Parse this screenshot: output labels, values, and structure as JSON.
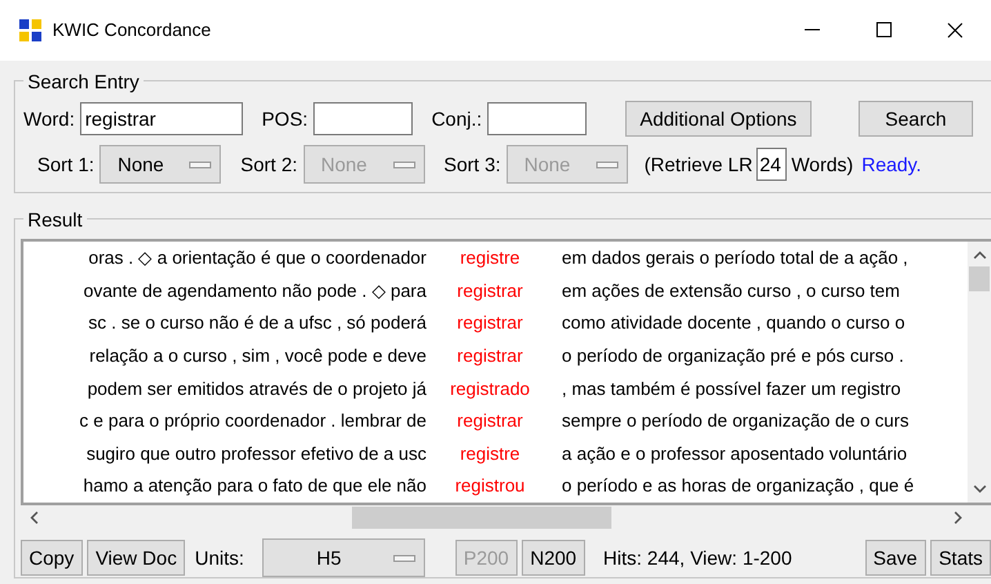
{
  "window": {
    "title": "KWIC Concordance"
  },
  "search_entry": {
    "legend": "Search Entry",
    "word": {
      "label": "Word:",
      "value": "registrar"
    },
    "pos": {
      "label": "POS:"
    },
    "conj": {
      "label": "Conj.:"
    },
    "buttons": [
      "Additional Options",
      "Search"
    ],
    "sorts": [
      {
        "label": "Sort 1:",
        "value": "None",
        "disabled": false
      },
      {
        "label": "Sort 2:",
        "value": "None",
        "disabled": true
      },
      {
        "label": "Sort 3:",
        "value": "None",
        "disabled": true
      }
    ],
    "retrieve_prefix": "(Retrieve LR",
    "retrieve_value": "24",
    "retrieve_suffix": "Words)",
    "status": "Ready."
  },
  "result": {
    "legend": "Result",
    "rows": [
      {
        "left": "oras . ◇ a orientação é que o coordenador",
        "keyword": "registre",
        "right": "em dados gerais o período total de a ação ,"
      },
      {
        "left": "ovante de agendamento não pode . ◇ para",
        "keyword": "registrar",
        "right": "em ações de extensão curso , o curso tem"
      },
      {
        "left": "sc . se o curso não é de a ufsc , só poderá",
        "keyword": "registrar",
        "right": "como atividade docente , quando o curso o"
      },
      {
        "left": "relação a o curso , sim , você pode e deve",
        "keyword": "registrar",
        "right": "o período de organização pré e pós curso ."
      },
      {
        "left": "podem ser emitidos através de o projeto já",
        "keyword": "registrado",
        "right": ", mas também é possível fazer um registro"
      },
      {
        "left": "c e para o próprio coordenador . lembrar de",
        "keyword": "registrar",
        "right": "sempre o período de organização de o curs"
      },
      {
        "left": "sugiro que outro professor efetivo de a usc",
        "keyword": "registre",
        "right": "a ação e o professor aposentado voluntário"
      },
      {
        "left": "hamo a atenção para o fato de que ele não",
        "keyword": "registrou",
        "right": "o período e as horas de organização , que é"
      }
    ]
  },
  "bottom_bar": {
    "buttons": [
      {
        "label": "Copy",
        "disabled": false
      },
      {
        "label": "View Doc",
        "disabled": false
      }
    ],
    "units_label": "Units:",
    "units_value": "H5",
    "pager": [
      {
        "label": "P200",
        "disabled": true
      },
      {
        "label": "N200",
        "disabled": false
      }
    ],
    "hits": "Hits: 244, View: 1-200",
    "right_buttons": [
      {
        "label": "Save",
        "disabled": false
      },
      {
        "label": "Stats",
        "disabled": false
      }
    ]
  }
}
